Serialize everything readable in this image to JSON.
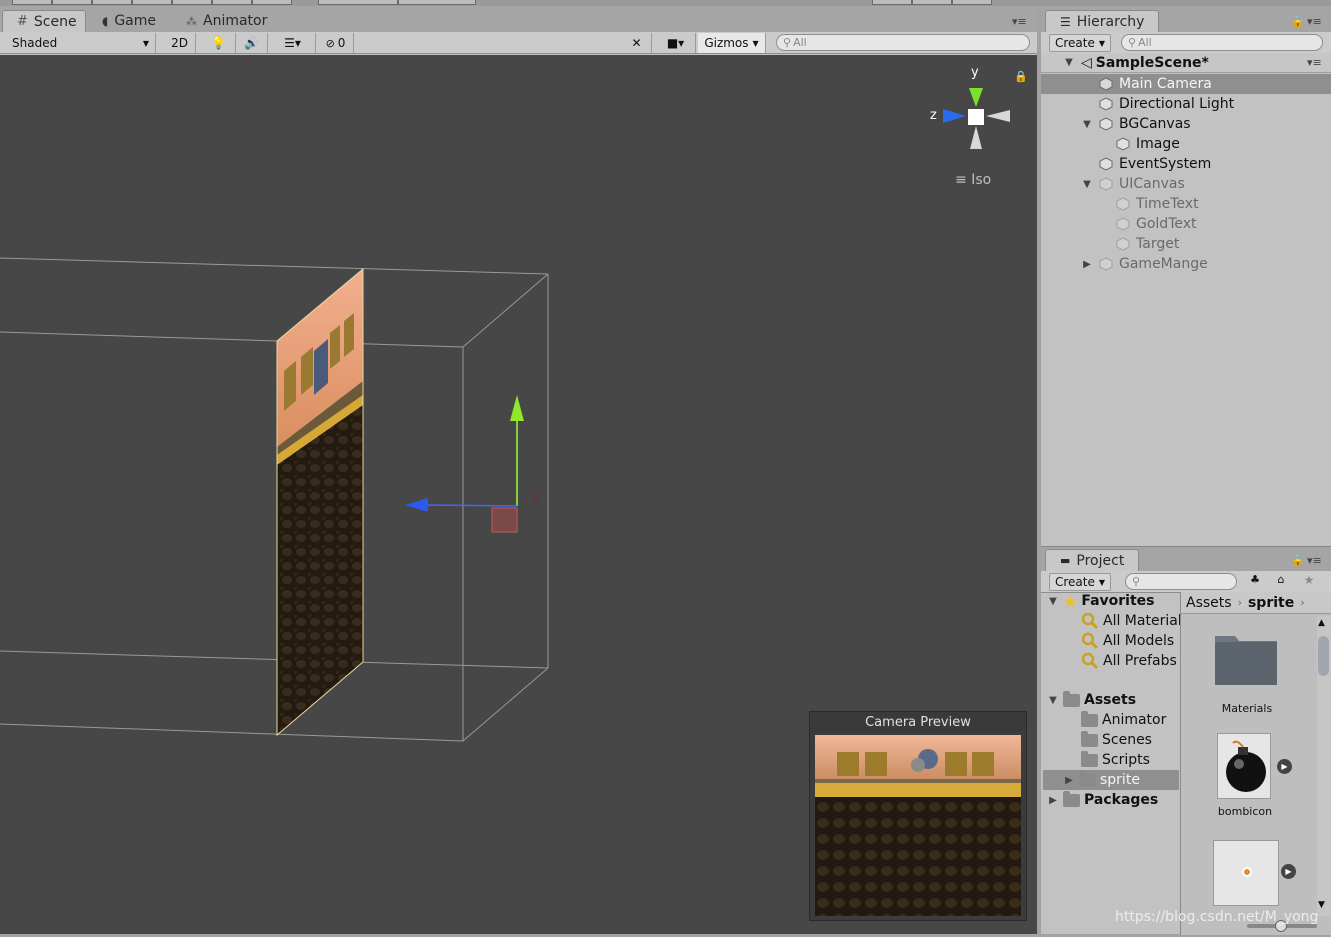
{
  "scene_tabs": [
    {
      "label": "Scene",
      "icon": "grid-icon",
      "active": true
    },
    {
      "label": "Game",
      "icon": "pacman-icon",
      "active": false
    },
    {
      "label": "Animator",
      "icon": "animator-icon",
      "active": false
    }
  ],
  "scene_toolbar": {
    "shading_mode": "Shaded",
    "mode_2d": "2D",
    "hidden_count": "0",
    "gizmos": "Gizmos",
    "search_placeholder": "All"
  },
  "orientation_gizmo": {
    "y_label": "y",
    "z_label": "z",
    "projection": "Iso"
  },
  "camera_preview": {
    "title": "Camera Preview"
  },
  "hierarchy": {
    "title": "Hierarchy",
    "create": "Create",
    "search_placeholder": "All",
    "scene_name": "SampleScene*",
    "items": [
      {
        "label": "Main Camera",
        "selected": true,
        "disabled": false
      },
      {
        "label": "Directional Light",
        "selected": false,
        "disabled": false
      },
      {
        "label": "BGCanvas",
        "selected": false,
        "disabled": false
      },
      {
        "label": "Image",
        "selected": false,
        "disabled": false
      },
      {
        "label": "EventSystem",
        "selected": false,
        "disabled": false
      },
      {
        "label": "UICanvas",
        "selected": false,
        "disabled": true
      },
      {
        "label": "TimeText",
        "selected": false,
        "disabled": true
      },
      {
        "label": "GoldText",
        "selected": false,
        "disabled": true
      },
      {
        "label": "Target",
        "selected": false,
        "disabled": true
      },
      {
        "label": "GameMange",
        "selected": false,
        "disabled": true
      }
    ]
  },
  "project": {
    "title": "Project",
    "create": "Create",
    "favorites_label": "Favorites",
    "favorites": [
      "All Materials",
      "All Models",
      "All Prefabs"
    ],
    "assets_label": "Assets",
    "asset_folders": [
      "Animator",
      "Scenes",
      "Scripts",
      "sprite"
    ],
    "packages_label": "Packages",
    "breadcrumb": [
      "Assets",
      "sprite"
    ],
    "grid_items": [
      "Materials",
      "bombicon"
    ]
  },
  "watermark": "https://blog.csdn.net/M_yong"
}
